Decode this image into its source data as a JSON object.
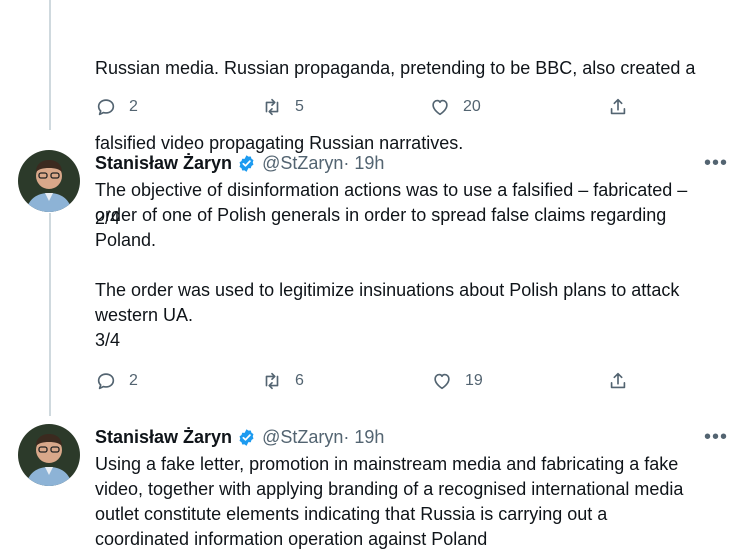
{
  "tweet_prev": {
    "lines": [
      "Russian media. Russian propaganda, pretending to be BBC, also created a",
      "falsified video propagating Russian narratives.",
      "2/4"
    ],
    "replies": "2",
    "retweets": "5",
    "likes": "20"
  },
  "tweet_3": {
    "name": "Stanisław Żaryn",
    "handle": "@StZaryn",
    "time": " · 19h",
    "text": "The objective of disinformation actions was to use a falsified – fabricated –\norder of one of Polish generals in order to spread false claims regarding\nPoland.\n\nThe order was used to legitimize insinuations about Polish plans to attack\nwestern UA.\n3/4",
    "replies": "2",
    "retweets": "6",
    "likes": "19"
  },
  "tweet_4": {
    "name": "Stanisław Żaryn",
    "handle": "@StZaryn",
    "time": " · 19h",
    "text": "Using a fake letter, promotion in mainstream media and fabricating a fake\nvideo, together with applying branding of a recognised international media\noutlet constitute elements indicating that Russia is carrying out a\ncoordinated information operation against Poland"
  },
  "icons": [
    "reply-icon",
    "retweet-icon",
    "like-icon",
    "share-icon",
    "more-icon",
    "verified-badge-icon"
  ],
  "colors": {
    "text": "#0f1419",
    "muted": "#536471",
    "verified": "#1d9bf0",
    "thread_line": "#cfd9de"
  }
}
